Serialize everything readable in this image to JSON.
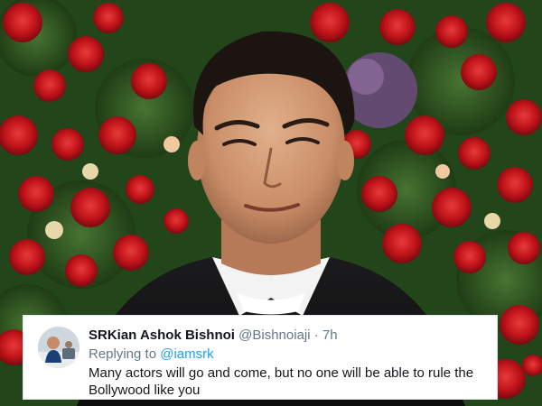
{
  "tweet": {
    "display_name": "SRKian Ashok Bishnoi",
    "handle": "@Bishnoiaji",
    "separator": "·",
    "time": "7h",
    "replying_to_label": "Replying to",
    "replying_to_handle": "@iamsrk",
    "text": "Many actors will go and come, but no one will be able to rule the Bollywood like you"
  },
  "colors": {
    "mention": "#1da1f2",
    "name": "#14171a",
    "meta": "#657786",
    "roses": "#c0141a",
    "foliage": "#2f5a20"
  },
  "icons": {
    "avatar": "avatar-photo"
  }
}
